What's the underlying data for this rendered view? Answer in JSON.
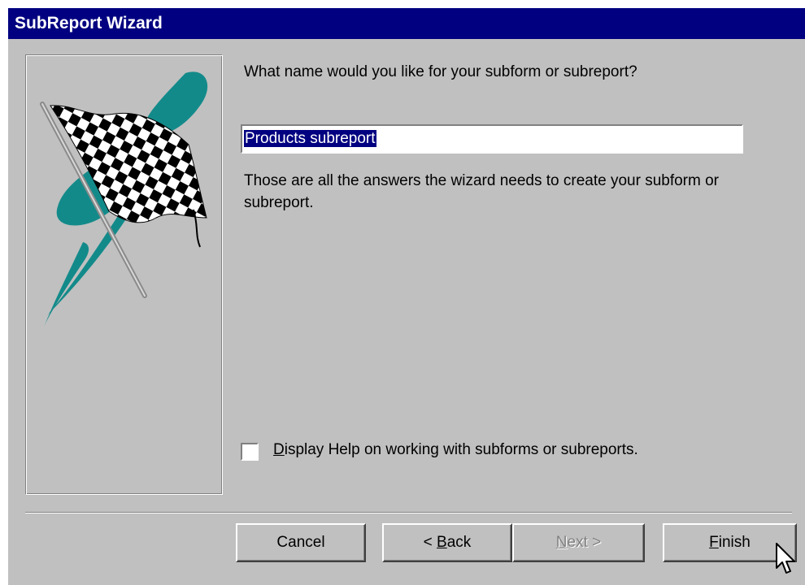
{
  "window": {
    "title": "SubReport Wizard"
  },
  "prompt": {
    "question": "What name would you like for your subform or subreport?"
  },
  "name_field": {
    "value": "Products subreport"
  },
  "info_text": "Those are all the answers the wizard needs to create your subform or subreport.",
  "help_checkbox": {
    "checked": false,
    "label_mnemonic": "D",
    "label_rest": "isplay Help on working with subforms or subreports."
  },
  "buttons": {
    "cancel": "Cancel",
    "back_prefix": "< ",
    "back_mnemonic": "B",
    "back_rest": "ack",
    "next_mnemonic": "N",
    "next_rest": "ext >",
    "finish_mnemonic": "F",
    "finish_rest": "inish"
  },
  "icons": {
    "graphic": "checkered-flag-icon",
    "cursor": "mouse-pointer-icon"
  },
  "colors": {
    "title_bar": "#000080",
    "window_face": "#c0c0c0",
    "selection": "#000080",
    "flag_teal": "#138a8a"
  }
}
